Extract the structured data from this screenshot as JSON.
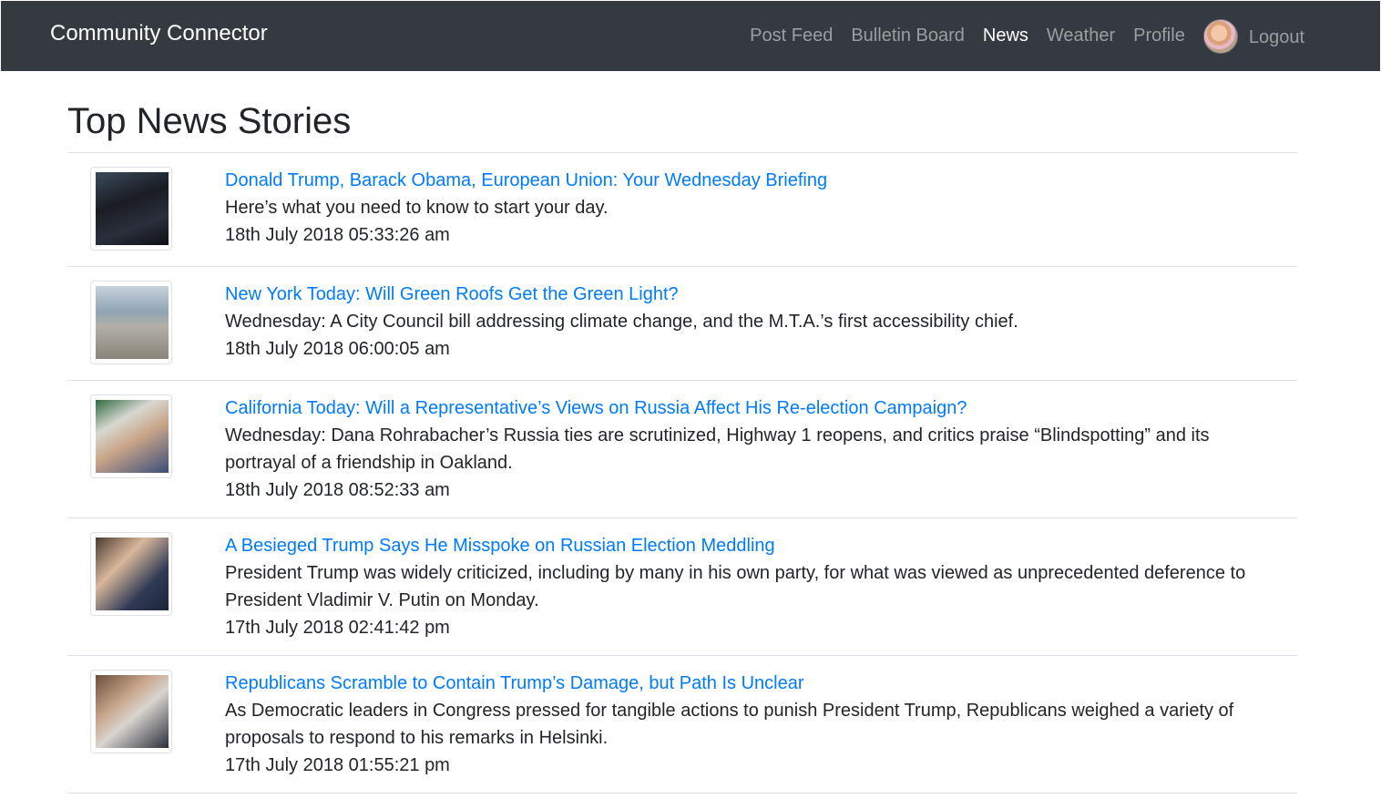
{
  "navbar": {
    "brand": "Community Connector",
    "links": [
      "Post Feed",
      "Bulletin Board",
      "News",
      "Weather",
      "Profile"
    ],
    "active": "News",
    "logout": "Logout"
  },
  "page": {
    "title": "Top News Stories"
  },
  "stories": [
    {
      "title": "Donald Trump, Barack Obama, European Union: Your Wednesday Briefing",
      "description": "Here’s what you need to know to start your day.",
      "date": "18th July 2018 05:33:26 am"
    },
    {
      "title": "New York Today: Will Green Roofs Get the Green Light?",
      "description": "Wednesday: A City Council bill addressing climate change, and the M.T.A.’s first accessibility chief.",
      "date": "18th July 2018 06:00:05 am"
    },
    {
      "title": "California Today: Will a Representative’s Views on Russia Affect His Re-election Campaign?",
      "description": "Wednesday: Dana Rohrabacher’s Russia ties are scrutinized, Highway 1 reopens, and critics praise “Blindspotting” and its portrayal of a friendship in Oakland.",
      "date": "18th July 2018 08:52:33 am"
    },
    {
      "title": "A Besieged Trump Says He Misspoke on Russian Election Meddling",
      "description": "President Trump was widely criticized, including by many in his own party, for what was viewed as unprecedented deference to President Vladimir V. Putin on Monday.",
      "date": "17th July 2018 02:41:42 pm"
    },
    {
      "title": "Republicans Scramble to Contain Trump’s Damage, but Path Is Unclear",
      "description": "As Democratic leaders in Congress pressed for tangible actions to punish President Trump, Republicans weighed a variety of proposals to respond to his remarks in Helsinki.",
      "date": "17th July 2018 01:55:21 pm"
    }
  ],
  "colors": {
    "navbar_bg": "#343a40",
    "link": "#007bff",
    "text": "#212529",
    "divider": "#dee2e6"
  }
}
